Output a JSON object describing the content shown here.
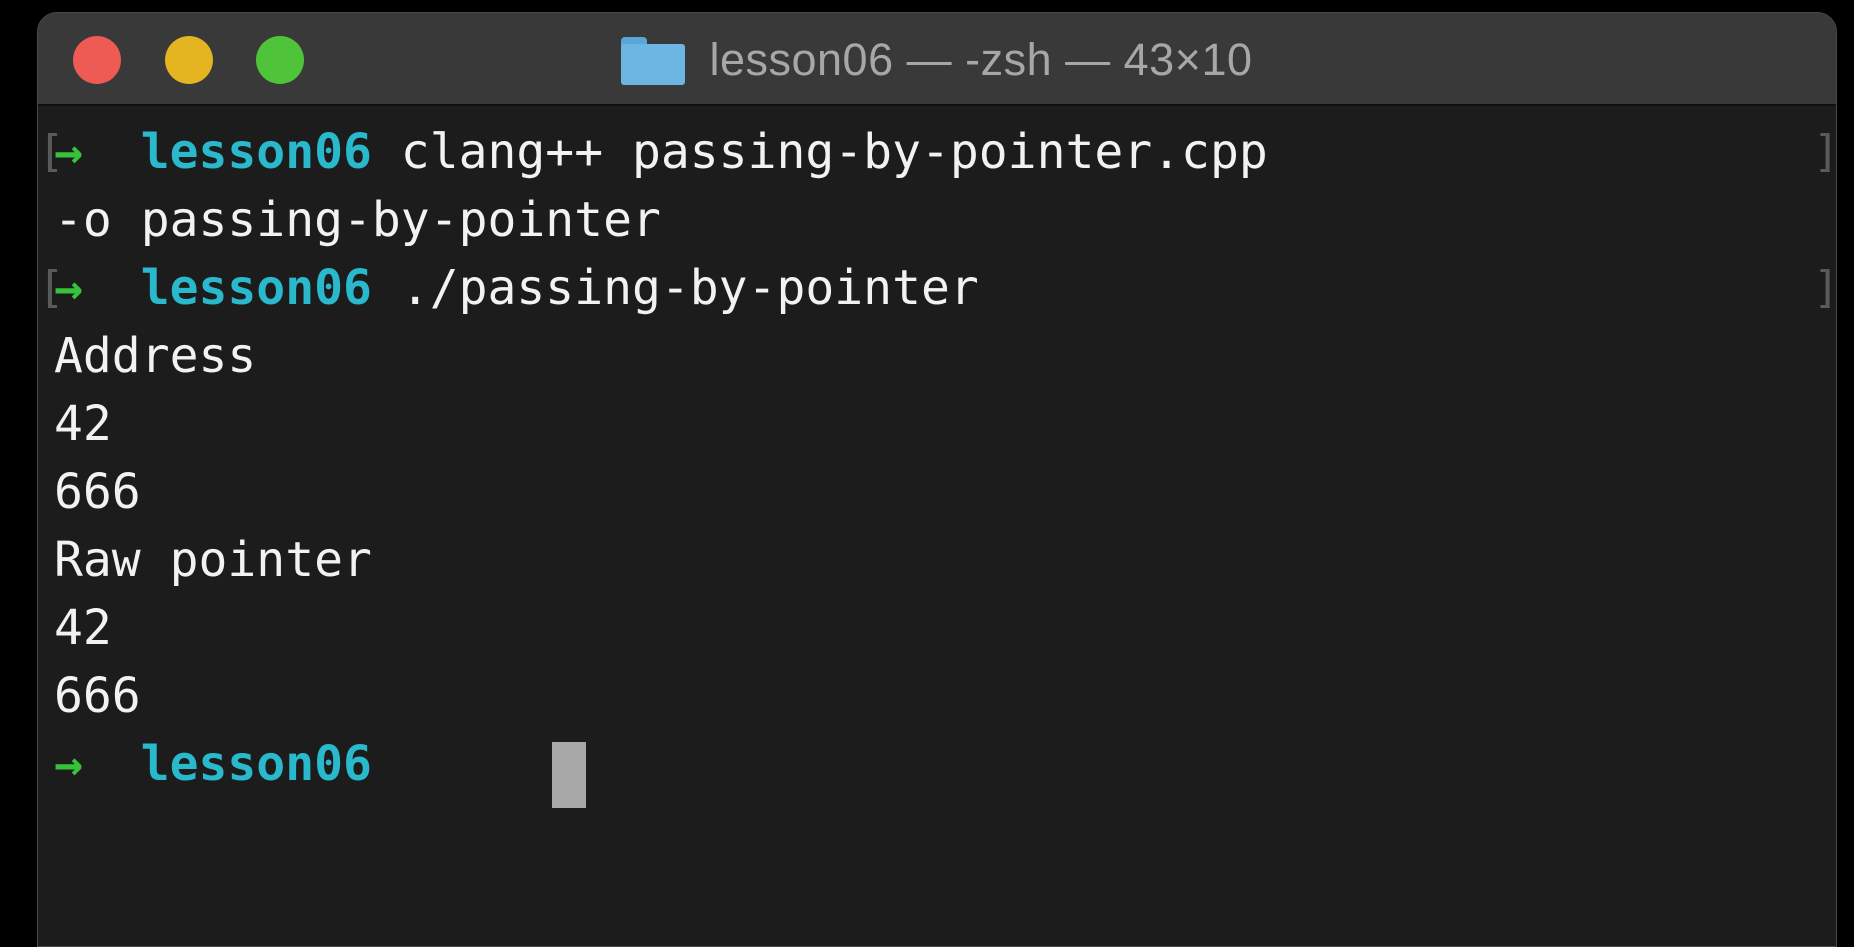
{
  "window": {
    "title": "lesson06 — -zsh — 43×10",
    "folder_icon": "folder-icon"
  },
  "traffic_lights": {
    "close_color": "#ee5a54",
    "minimize_color": "#e5b421",
    "zoom_color": "#4fc33a"
  },
  "prompt": {
    "arrow": "→",
    "directory": "lesson06",
    "arrow_color": "#38c13a",
    "directory_color": "#29b8cc"
  },
  "lines": [
    {
      "kind": "command",
      "text": "clang++ passing-by-pointer.cpp"
    },
    {
      "kind": "wrap",
      "text": "-o passing-by-pointer"
    },
    {
      "kind": "command",
      "text": "./passing-by-pointer"
    },
    {
      "kind": "output",
      "text": "Address"
    },
    {
      "kind": "output",
      "text": "42"
    },
    {
      "kind": "output",
      "text": "666"
    },
    {
      "kind": "output",
      "text": "Raw pointer"
    },
    {
      "kind": "output",
      "text": "42"
    },
    {
      "kind": "output",
      "text": "666"
    },
    {
      "kind": "prompt",
      "text": ""
    }
  ],
  "marks": {
    "open": "[",
    "close": "]"
  }
}
